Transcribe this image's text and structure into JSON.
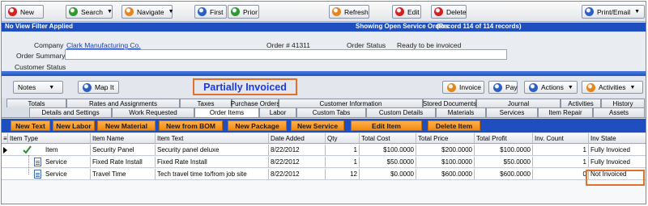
{
  "toolbar": {
    "new": "New",
    "search": "Search",
    "navigate": "Navigate",
    "first": "First",
    "prior": "Prior",
    "refresh": "Refresh",
    "edit": "Edit",
    "delete": "Delete",
    "print_email": "Print/Email"
  },
  "bluebar": {
    "filter": "No View Filter Applied",
    "showing": "Showing Open Service Orders",
    "record": "(Record 114 of 114 records)"
  },
  "header": {
    "company_label": "Company",
    "company_value": "Clark Manufacturing Co.",
    "order_label": "Order #",
    "order_value": "41311",
    "status_label": "Order Status",
    "status_value": "Ready to be invoiced",
    "summary_label": "Order Summary",
    "summary_value": "",
    "customer_status_label": "Customer Status"
  },
  "bar2": {
    "notes": "Notes",
    "map_it": "Map It",
    "partial": "Partially Invoiced",
    "invoice": "Invoice",
    "pay": "Pay",
    "actions": "Actions",
    "activities": "Activities"
  },
  "tabs_row1": [
    "Totals",
    "Rates and Assignments",
    "Taxes",
    "Purchase Orders",
    "Customer Information",
    "Stored Documents",
    "Journal",
    "Activities",
    "History"
  ],
  "tabs_row2": [
    "Details and Settings",
    "Work Requested",
    "Order Items",
    "Labor",
    "Custom Tabs",
    "Custom Details",
    "Materials",
    "Services",
    "Item Repair",
    "Assets"
  ],
  "actions": [
    "New Text",
    "New Labor",
    "New Material",
    "New from BOM",
    "New Package",
    "New Service",
    "Edit Item",
    "Delete Item"
  ],
  "grid": {
    "columns": [
      "Item Type",
      "Item Name",
      "Item Text",
      "Date Added",
      "Qty",
      "Total Cost",
      "Total Price",
      "Total Profit",
      "Inv. Count",
      "Inv State"
    ],
    "rows": [
      [
        "Item",
        "Security Panel",
        "Security panel deluxe",
        "8/22/2012",
        "1",
        "$100.0000",
        "$200.0000",
        "$100.0000",
        "1",
        "Fully Invoiced"
      ],
      [
        "Service",
        "Fixed Rate Install",
        "Fixed Rate Install",
        "8/22/2012",
        "1",
        "$50.0000",
        "$100.0000",
        "$50.0000",
        "1",
        "Fully Invoiced"
      ],
      [
        "Service",
        "Travel Time",
        "Tech travel time to/from job site",
        "8/22/2012",
        "12",
        "$0.0000",
        "$600.0000",
        "$600.0000",
        "0",
        "Not Invoiced"
      ]
    ]
  },
  "colors": {
    "accent_blue": "#1f4fbe",
    "action_orange": "#f28a12",
    "highlight": "#e0702a"
  }
}
